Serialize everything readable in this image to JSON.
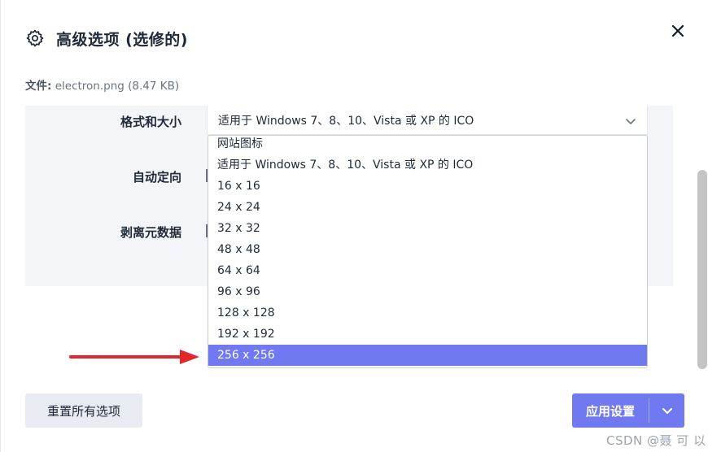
{
  "dialog": {
    "title": "高级选项 (选修的)",
    "file_label": "文件:",
    "file_value": "electron.png (8.47 KB)"
  },
  "form": {
    "format_label": "格式和大小",
    "format_selected": "适用于 Windows 7、8、10、Vista 或 XP 的 ICO",
    "auto_orient_label": "自动定向",
    "strip_metadata_label": "剥离元数据"
  },
  "dropdown": {
    "options": [
      "网站图标",
      "适用于 Windows 7、8、10、Vista 或 XP 的 ICO",
      "16 x 16",
      "24 x 24",
      "32 x 32",
      "48 x 48",
      "64 x 64",
      "96 x 96",
      "128 x 128",
      "192 x 192",
      "256 x 256"
    ],
    "highlighted": "256 x 256"
  },
  "footer": {
    "reset_label": "重置所有选项",
    "apply_label": "应用设置"
  },
  "watermark": "CSDN @聂 可 以",
  "colors": {
    "accent": "#7079f0",
    "panel": "#f4f5f8",
    "arrow": "#e3262c"
  }
}
